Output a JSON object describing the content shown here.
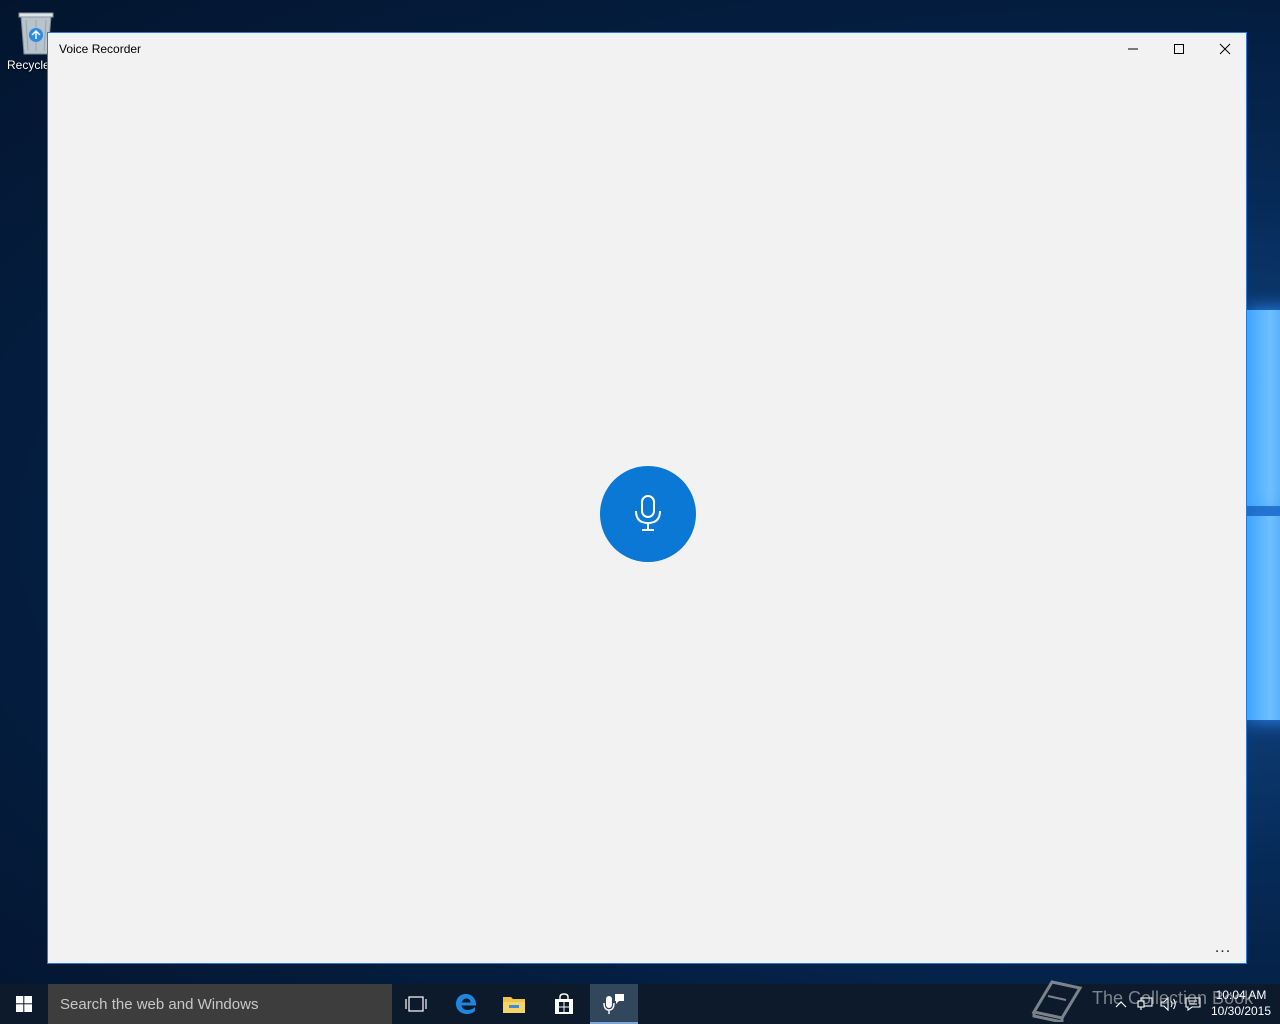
{
  "desktop": {
    "recycle_bin_label": "Recycle"
  },
  "window": {
    "title": "Voice Recorder",
    "minimize_label": "Minimize",
    "maximize_label": "Maximize",
    "close_label": "Close",
    "more_options_label": "..."
  },
  "taskbar": {
    "search_placeholder": "Search the web and Windows",
    "clock_time": "10:04 AM",
    "clock_date": "10/30/2015"
  },
  "watermark": {
    "text": "The Collection Book"
  },
  "icons": {
    "start": "windows-logo-icon",
    "task_view": "task-view-icon",
    "edge": "edge-browser-icon",
    "explorer": "folder-icon",
    "store": "store-bag-icon",
    "recorder": "microphone-icon",
    "record": "microphone-icon",
    "tray_chevron": "chevron-up-icon",
    "network": "network-icon",
    "volume": "volume-icon",
    "action_center": "notification-icon"
  },
  "colors": {
    "accent": "#0a78d4",
    "window_bg": "#f2f2f2",
    "taskbar_bg": "#0c1a2b",
    "search_bg": "#3d3d3d"
  }
}
